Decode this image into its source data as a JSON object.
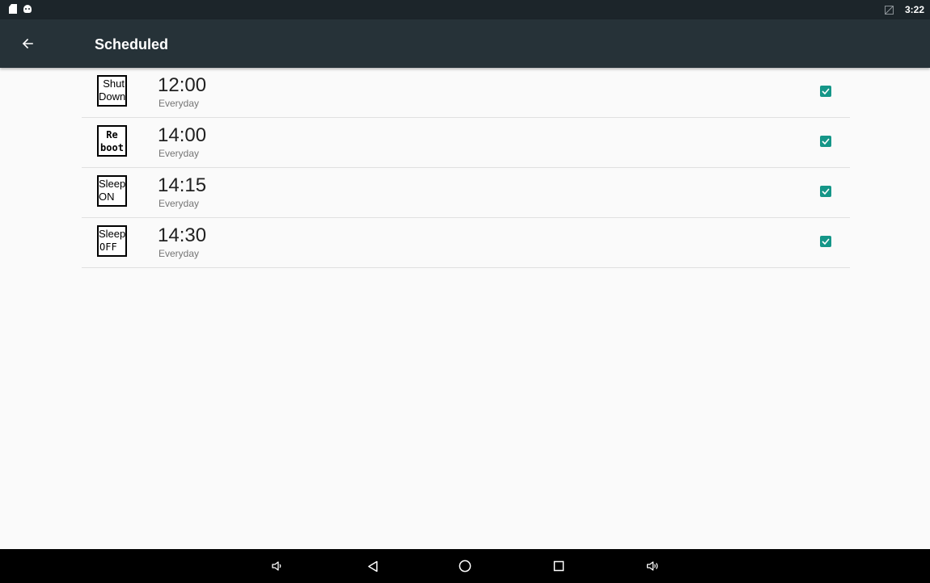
{
  "status_bar": {
    "time": "3:22",
    "left_icons": [
      "sd-card-icon",
      "android-debug-icon"
    ],
    "right_icons": [
      "no-signal-icon"
    ]
  },
  "app_bar": {
    "title": "Scheduled",
    "back_icon": "arrow-back-icon",
    "background": "#263238"
  },
  "schedules": [
    {
      "icon_line1": "Shut",
      "icon_line2": "Down",
      "time": "12:00",
      "repeat": "Everyday",
      "checked": true
    },
    {
      "icon_line1": "Re",
      "icon_line2": "boot",
      "time": "14:00",
      "repeat": "Everyday",
      "checked": true
    },
    {
      "icon_line1": "Sleep",
      "icon_line2": "ON",
      "time": "14:15",
      "repeat": "Everyday",
      "checked": true
    },
    {
      "icon_line1": "Sleep",
      "icon_line2": "OFF",
      "time": "14:30",
      "repeat": "Everyday",
      "checked": true
    }
  ],
  "accent_color": "#159688",
  "nav_bar": {
    "buttons": [
      "volume-down-icon",
      "back-triangle-icon",
      "home-circle-icon",
      "recents-square-icon",
      "volume-up-icon"
    ]
  }
}
